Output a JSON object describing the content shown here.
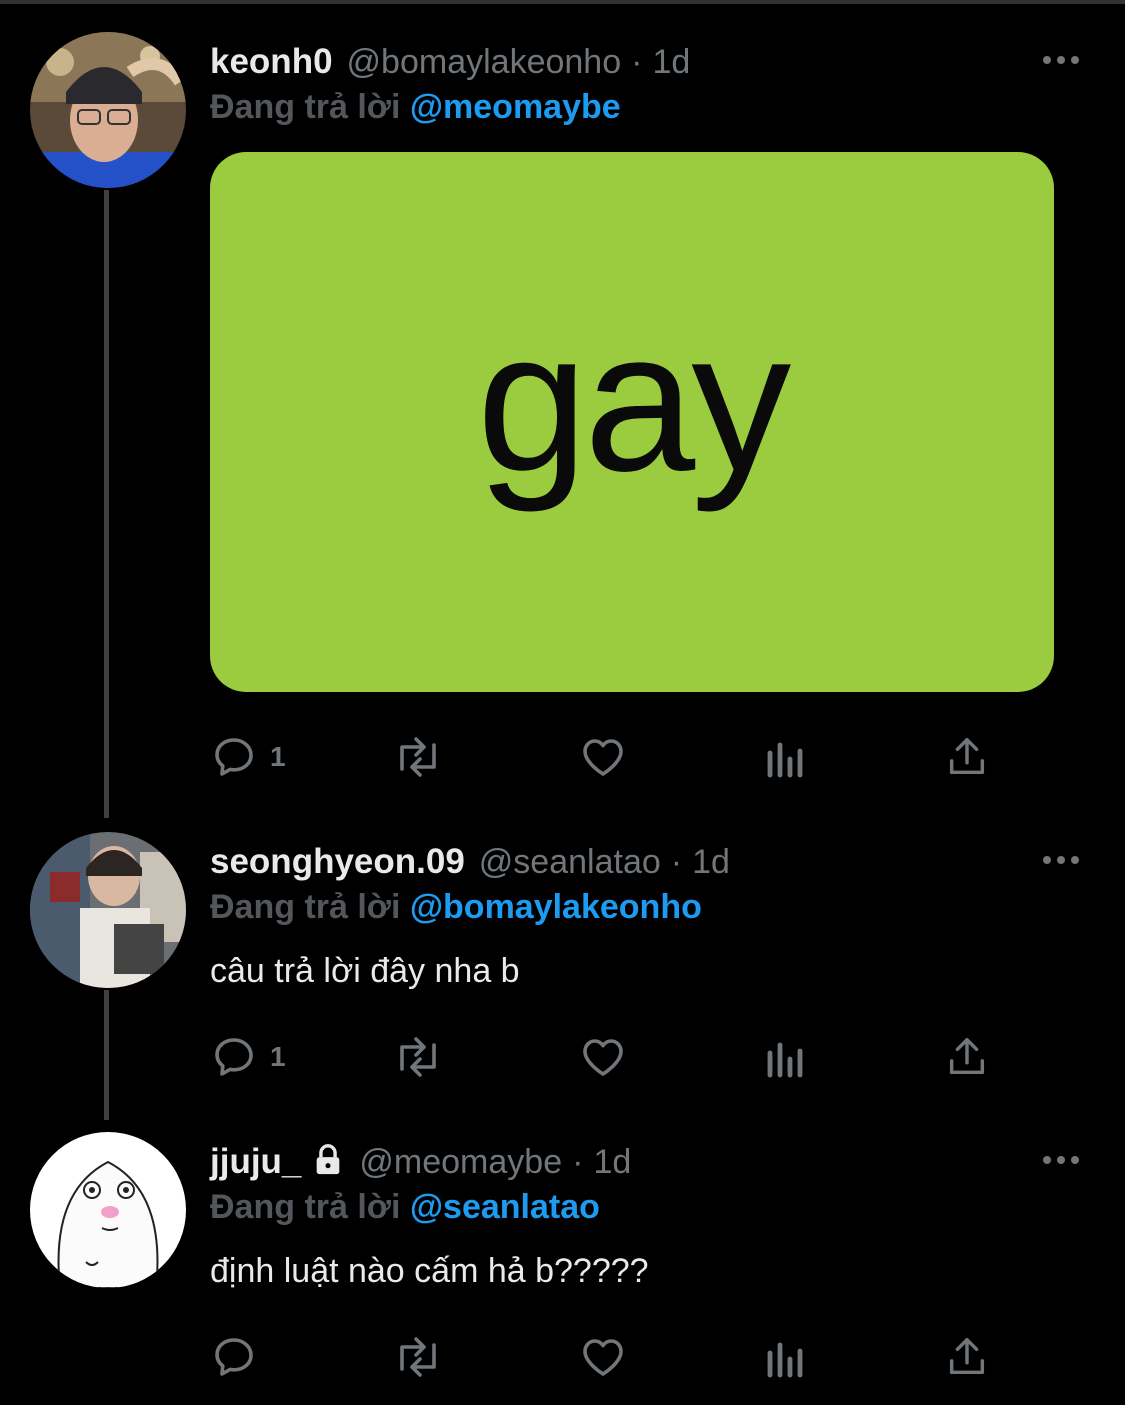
{
  "tweets": [
    {
      "display_name": "keonh0",
      "handle": "@bomaylakeonho",
      "separator": "·",
      "time": "1d",
      "replying_prefix": "Đang trả lời",
      "replying_to": "@meomaybe",
      "text": "",
      "media_text": "gay",
      "reply_count": "1",
      "locked": false
    },
    {
      "display_name": "seonghyeon.09",
      "handle": "@seanlatao",
      "separator": "·",
      "time": "1d",
      "replying_prefix": "Đang trả lời",
      "replying_to": "@bomaylakeonho",
      "text": "câu trả lời đây nha b",
      "reply_count": "1",
      "locked": false
    },
    {
      "display_name": "jjuju_",
      "handle": "@meomaybe",
      "separator": "·",
      "time": "1d",
      "replying_prefix": "Đang trả lời",
      "replying_to": "@seanlatao",
      "text": "định luật nào cấm hả b?????",
      "reply_count": "",
      "locked": true
    }
  ],
  "icons": {
    "more": "more-horizontal-icon",
    "reply": "speech-bubble-icon",
    "retweet": "retweet-icon",
    "like": "heart-icon",
    "views": "bar-chart-icon",
    "share": "share-upload-icon",
    "lock": "lock-icon"
  },
  "colors": {
    "background": "#000000",
    "text": "#e7e9ea",
    "secondary": "#71767b",
    "mention": "#1d9bf0",
    "media_green": "#9bcc3f"
  }
}
